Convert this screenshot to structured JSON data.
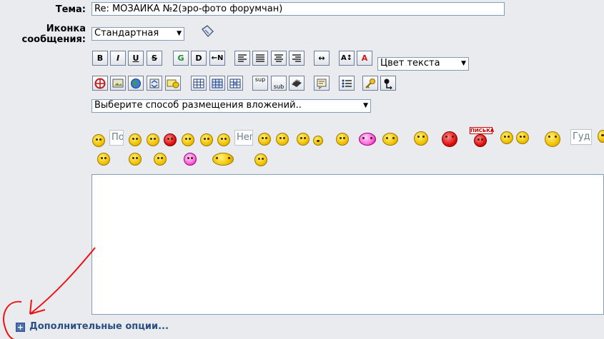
{
  "form": {
    "subject_label": "Тема:",
    "subject_value": "Re: МОЗАИКА №2(эро-фото форумчан)",
    "icon_label_line1": "Иконка",
    "icon_label_line2": "сообщения:",
    "icon_select_value": "Стандартная",
    "color_select_value": "Цвет текста",
    "attachment_select_value": "Выберите способ размещения вложений..",
    "message_text": ""
  },
  "toolbar_row1": [
    "B",
    "I",
    "U",
    "S",
    "G",
    "D",
    "←N",
    "left",
    "justify",
    "center",
    "right",
    "↔",
    "A↕",
    "A"
  ],
  "toolbar_row2": [
    "sup",
    "sub"
  ],
  "smiley_text_labels": [
    "По",
    "Неп",
    "Гуд"
  ],
  "smiley_sign_text": "ПИСЬКА",
  "more_options": "Дополнительные опции...",
  "colors": {
    "link": "#2a4f86",
    "annotation": "#ee1111",
    "background": "#e9ebee"
  }
}
